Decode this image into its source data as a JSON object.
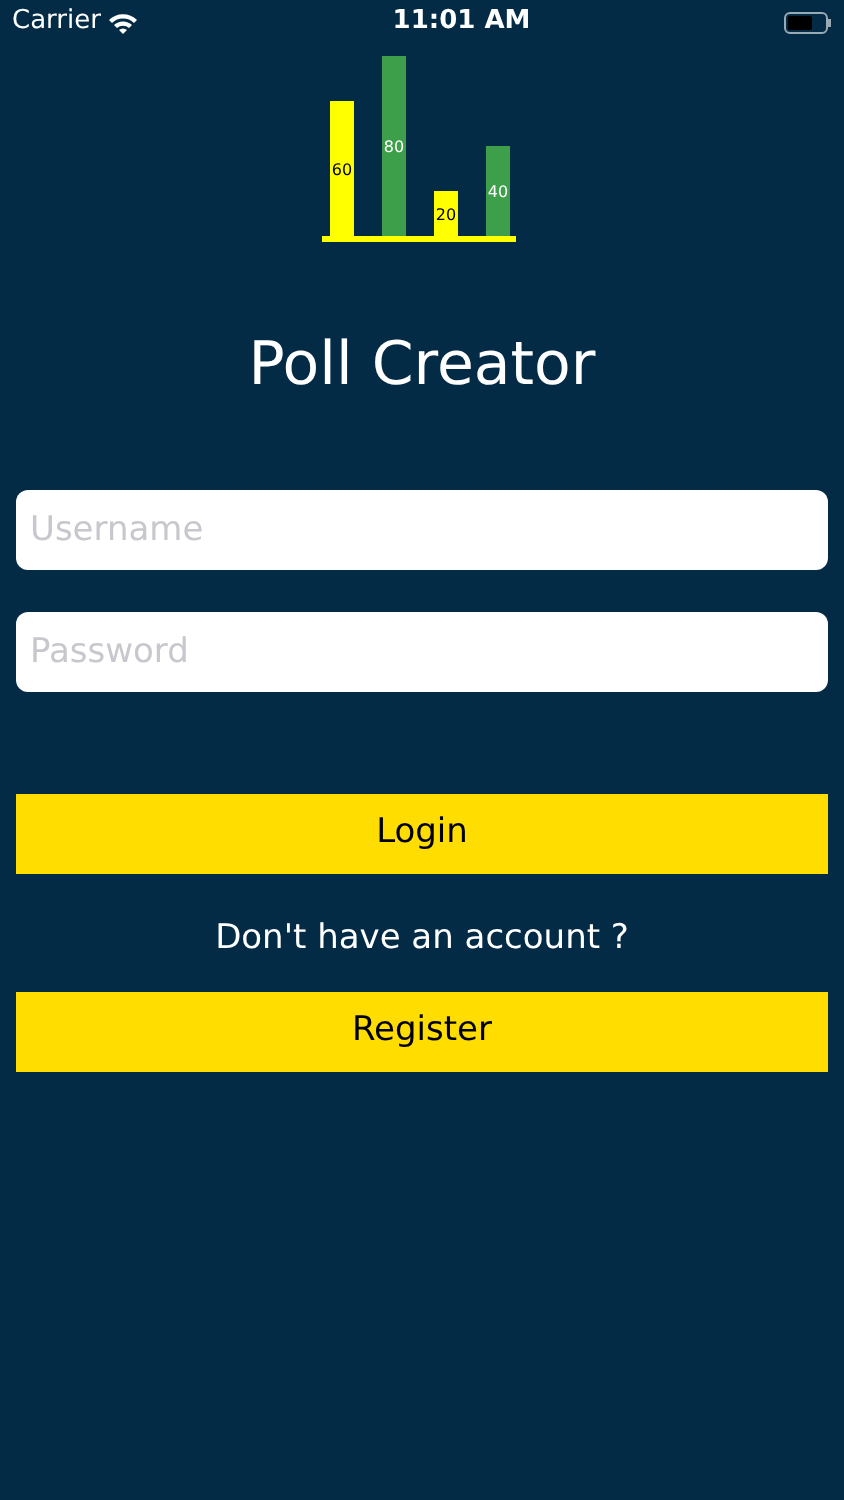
{
  "status_bar": {
    "carrier": "Carrier",
    "time": "11:01 AM"
  },
  "logo": {
    "chart_data": {
      "type": "bar",
      "values": [
        60,
        80,
        20,
        40
      ],
      "colors": [
        "#ffff00",
        "#3e9f4a",
        "#ffff00",
        "#3e9f4a"
      ],
      "data_labels": true
    }
  },
  "title": "Poll Creator",
  "fields": [
    {
      "placeholder": "Username"
    },
    {
      "placeholder": "Password"
    }
  ],
  "login_button": "Login",
  "prompt": "Don't have an account ?",
  "register_button": "Register"
}
